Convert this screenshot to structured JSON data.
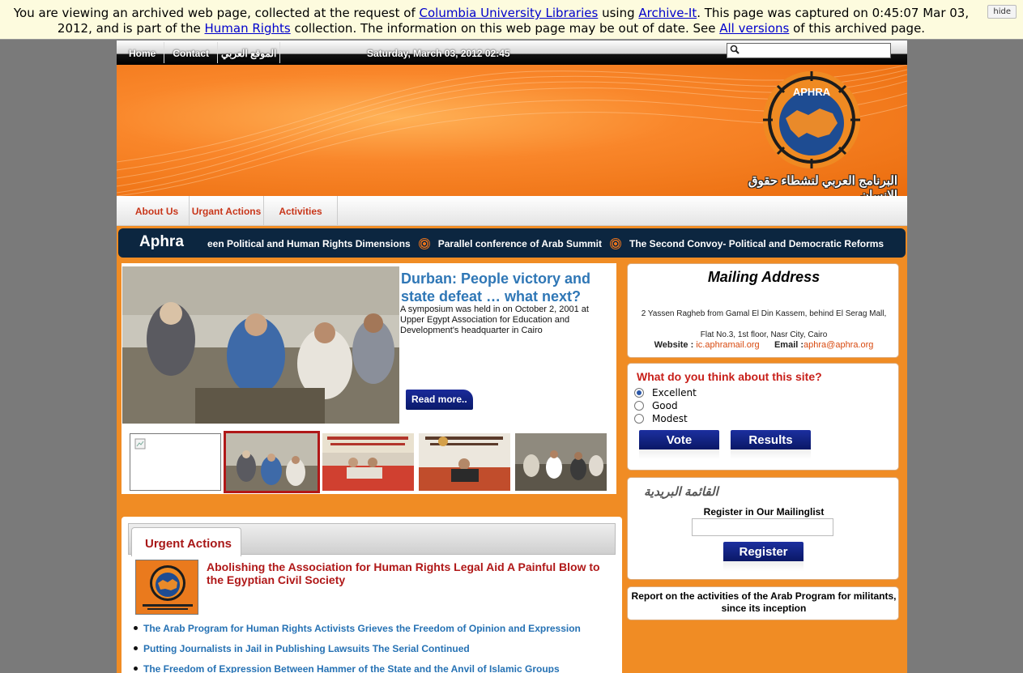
{
  "archive": {
    "t1": "You are viewing an archived web page, collected at the request of ",
    "l1": "Columbia University Libraries",
    "t2": " using ",
    "l2": "Archive-It",
    "t3": ". This page was captured on 0:45:07 Mar 03, 2012, and is part of the ",
    "l3": "Human Rights",
    "t4": " collection. The information on this web page may be out of date. See ",
    "l4": "All versions",
    "t5": " of this archived page.",
    "hide": "hide"
  },
  "topnav": {
    "items": [
      "Home",
      "Contact",
      "الموقع العربي"
    ],
    "date": "Saturday, March 03, 2012 02:45",
    "search_placeholder": ""
  },
  "header": {
    "logo_text": "APHRA",
    "tagline_ar": "البرنامج العربي لنشطاء حقوق الإنسان"
  },
  "menu": [
    "About Us",
    "Urgant Actions",
    "Activities"
  ],
  "ticker": {
    "title": "Aphra",
    "items": [
      "een Political and Human Rights Dimensions",
      "Parallel conference of Arab Summit",
      "The Second Convoy- Political and Democratic Reforms"
    ]
  },
  "featured": {
    "title": "Durban: People victory and state defeat … what next?",
    "desc": "A symposium was held in on October 2, 2001 at Upper Egypt Association for Education and Development's headquarter in Cairo",
    "read_more": "Read more.."
  },
  "urgent": {
    "tab": "Urgent Actions",
    "headline": "Abolishing the Association for Human Rights Legal Aid A Painful Blow to the Egyptian Civil Society",
    "items": [
      "The Arab Program for Human Rights Activists Grieves the Freedom of Opinion and Expression",
      "Putting Journalists in Jail in Publishing Lawsuits The Serial Continued",
      "The Freedom of Expression Between Hammer of the State and the Anvil of Islamic Groups"
    ]
  },
  "mailing": {
    "title": "Mailing Address",
    "address": "2 Yassen Ragheb from Gamal El Din Kassem, behind El Serag Mall, Flat No.3, 1st floor, Nasr City, Cairo",
    "website_label": "Website :",
    "website": "ic.aphramail.org",
    "email_label": "Email :",
    "email": "aphra@aphra.org"
  },
  "poll": {
    "question": "What do you think about this site?",
    "options": [
      "Excellent",
      "Good",
      "Modest"
    ],
    "selected": "Excellent",
    "vote": "Vote",
    "results": "Results"
  },
  "mailinglist": {
    "title_ar": "القائمة البريدية",
    "label": "Register in Our Mailinglist",
    "button": "Register"
  },
  "report": {
    "text": "Report on the activities of the Arab Program for militants, since its inception"
  },
  "colors": {
    "orange": "#f08c24",
    "navy": "#0c2640",
    "link_blue": "#2672b4",
    "red": "#b01818"
  }
}
